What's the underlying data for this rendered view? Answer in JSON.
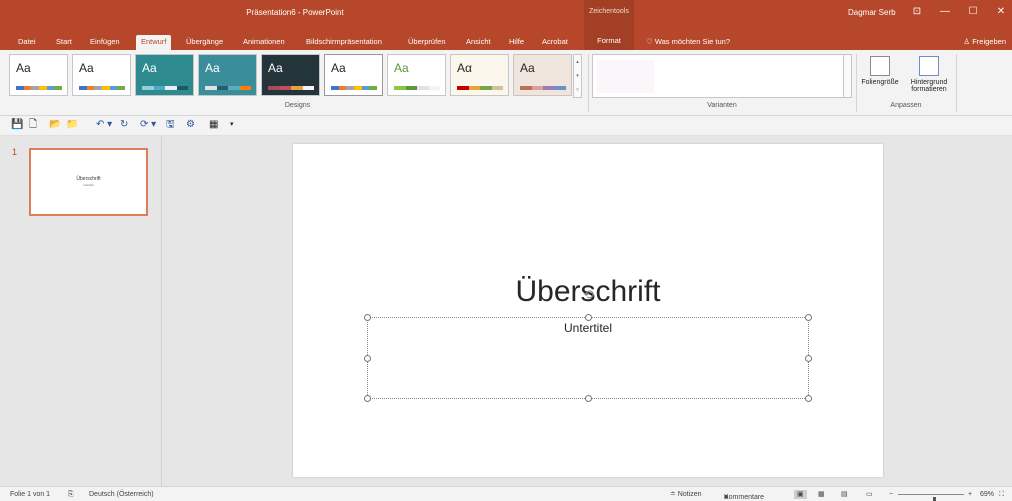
{
  "window": {
    "title": "Präsentation6 - PowerPoint",
    "context_header": "Zeichentools",
    "user": "Dagmar Serb",
    "controls": [
      "⊡",
      "—",
      "☐",
      "✕"
    ]
  },
  "tabs": [
    "Datei",
    "Start",
    "Einfügen",
    "Entwurf",
    "Übergänge",
    "Animationen",
    "Bildschirmpräsentation",
    "Überprüfen",
    "Ansicht",
    "Hilfe",
    "Acrobat",
    "Format"
  ],
  "active_tab": "Entwurf",
  "tell_me": "Was möchten Sie tun?",
  "share": "Freigeben",
  "ribbon": {
    "themes": [
      {
        "label": "Aa",
        "bg": "#ffffff",
        "fg": "#262626",
        "bar": [
          "#4472c4",
          "#ed7d31",
          "#a5a5a5",
          "#ffc000",
          "#5b9bd5",
          "#70ad47"
        ]
      },
      {
        "label": "Aa",
        "bg": "#ffffff",
        "fg": "#262626",
        "bar": [
          "#4472c4",
          "#ed7d31",
          "#a5a5a5",
          "#ffc000",
          "#5b9bd5",
          "#70ad47"
        ]
      },
      {
        "label": "Aa",
        "bg": "#2d8a8f",
        "fg": "#ffffff",
        "bar": [
          "#93cddd",
          "#4bacc6",
          "#e9edf4",
          "#1d5a60"
        ]
      },
      {
        "label": "Aa",
        "bg": "#3a8d9a",
        "fg": "#ffffff",
        "bar": [
          "#e2e2e2",
          "#2b5b6b",
          "#5aaebc",
          "#ff8000"
        ]
      },
      {
        "label": "Aa",
        "bg": "#24343b",
        "fg": "#ffffff",
        "bar": [
          "#a94b59",
          "#c0505f",
          "#e6a23c",
          "#f3f3f3"
        ]
      },
      {
        "label": "Aa",
        "bg": "#ffffff",
        "fg": "#262626",
        "bar": [
          "#4472c4",
          "#ed7d31",
          "#a5a5a5",
          "#ffc000",
          "#5b9bd5",
          "#70ad47"
        ]
      },
      {
        "label": "Aa",
        "bg": "#ffffff",
        "fg": "#5a9a3d",
        "bar": [
          "#8cc63f",
          "#5a9a3d",
          "#e2e2e2",
          "#f3f3f3"
        ]
      },
      {
        "label": "Aα",
        "bg": "#fbf7ec",
        "fg": "#262626",
        "bar": [
          "#c00000",
          "#e6a23c",
          "#76a64a",
          "#cfc19a"
        ]
      },
      {
        "label": "Aa",
        "bg": "#efe5dc",
        "fg": "#262626",
        "bar": [
          "#b37259",
          "#d9a0a0",
          "#9c7bb3",
          "#6b8fc7"
        ]
      }
    ],
    "designs_label": "Designs",
    "variants_label": "Varianten",
    "slide_size_label": "Foliengröße",
    "format_bg_label": "Hintergrund formatieren",
    "customize_label": "Anpassen"
  },
  "qat": [
    "💾",
    "🗋",
    "📂",
    "📁",
    "↶ ▾",
    "↻",
    "⟳ ▾",
    "🖫",
    "⚙",
    "▦",
    "▾"
  ],
  "slides": {
    "thumb_number": "1",
    "thumb_title": "Überschrift",
    "thumb_subtitle": "Untertitel"
  },
  "slide": {
    "title": "Überschrift",
    "subtitle": "Untertitel"
  },
  "status": {
    "slide_info": "Folie 1 von 1",
    "language": "Deutsch (Österreich)",
    "notes": "≐ Notizen",
    "comments": "Kommentare",
    "zoom_minus": "−",
    "zoom_plus": "+",
    "zoom": "69%",
    "zoom_fraction": 0.55
  }
}
